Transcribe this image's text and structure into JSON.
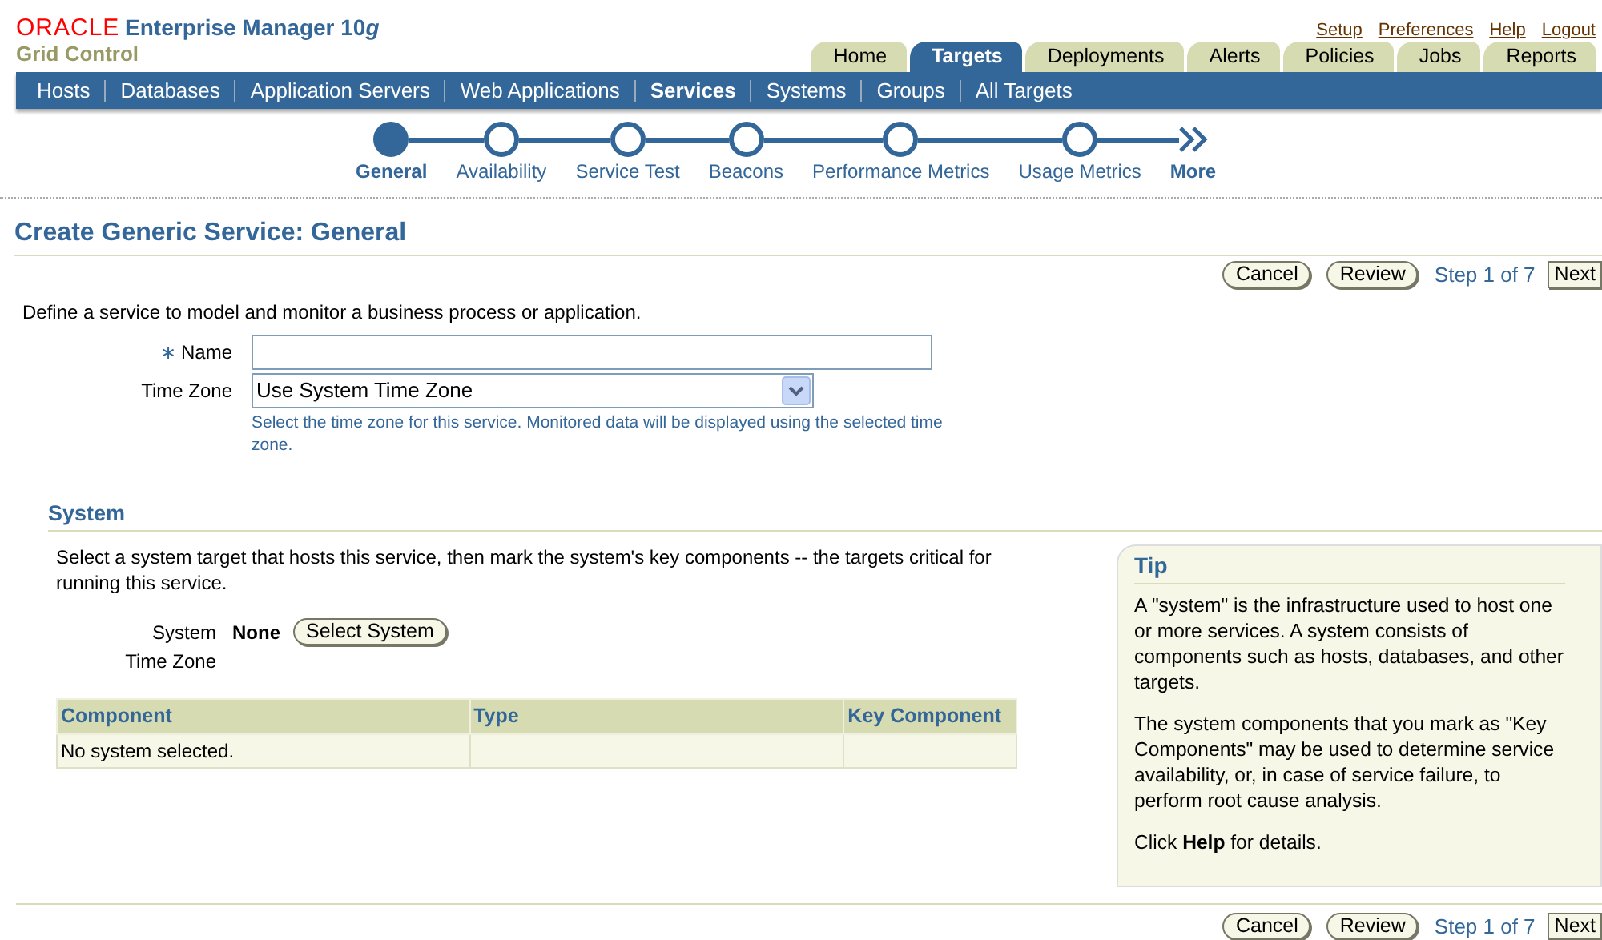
{
  "header": {
    "brand": "ORACLE",
    "product": "Enterprise Manager 10",
    "version_suffix": "g",
    "subtitle": "Grid Control"
  },
  "global_links": [
    "Setup",
    "Preferences",
    "Help",
    "Logout"
  ],
  "tabs": [
    {
      "label": "Home",
      "selected": false
    },
    {
      "label": "Targets",
      "selected": true
    },
    {
      "label": "Deployments",
      "selected": false
    },
    {
      "label": "Alerts",
      "selected": false
    },
    {
      "label": "Policies",
      "selected": false
    },
    {
      "label": "Jobs",
      "selected": false
    },
    {
      "label": "Reports",
      "selected": false
    }
  ],
  "subtabs": [
    {
      "label": "Hosts",
      "selected": false
    },
    {
      "label": "Databases",
      "selected": false
    },
    {
      "label": "Application Servers",
      "selected": false
    },
    {
      "label": "Web Applications",
      "selected": false
    },
    {
      "label": "Services",
      "selected": true
    },
    {
      "label": "Systems",
      "selected": false
    },
    {
      "label": "Groups",
      "selected": false
    },
    {
      "label": "All Targets",
      "selected": false
    }
  ],
  "train": {
    "steps": [
      {
        "label": "General",
        "selected": true
      },
      {
        "label": "Availability",
        "selected": false
      },
      {
        "label": "Service Test",
        "selected": false
      },
      {
        "label": "Beacons",
        "selected": false
      },
      {
        "label": "Performance Metrics",
        "selected": false
      },
      {
        "label": "Usage Metrics",
        "selected": false
      }
    ],
    "more": "More"
  },
  "page_title": "Create Generic Service: General",
  "actions_top": {
    "buttons": [
      "Cancel",
      "Review"
    ],
    "step": "Step 1 of 7",
    "next": "Next"
  },
  "intro": "Define a service to model and monitor a business process or application.",
  "form": {
    "name": {
      "marker": "∗",
      "label": "Name"
    },
    "time_zone": {
      "label": "Time Zone",
      "value": "Use System Time Zone",
      "hint": "Select the time zone for this service. Monitored data will be displayed using the selected time zone."
    }
  },
  "system": {
    "heading": "System",
    "description": "Select a system target that hosts this service, then mark the system's key components -- the targets critical for running this service.",
    "system_label": "System",
    "system_value": "None",
    "select_button": "Select System",
    "time_zone_label": "Time Zone",
    "table": {
      "columns": [
        "Component",
        "Type",
        "Key Component"
      ],
      "empty_message": "No system selected."
    }
  },
  "tip": {
    "title": "Tip",
    "paragraphs": [
      "A \"system\" is the infrastructure used to host one or more services. A system consists of components such as hosts, databases, and other targets.",
      "The system components that you mark as \"Key Components\" may be used to determine service availability, or, in case of service failure, to perform root cause analysis.",
      "Click **Help** for details."
    ]
  },
  "actions_bottom": {
    "buttons": [
      "Cancel",
      "Review"
    ],
    "step": "Step 1 of 7",
    "next": "Next"
  }
}
